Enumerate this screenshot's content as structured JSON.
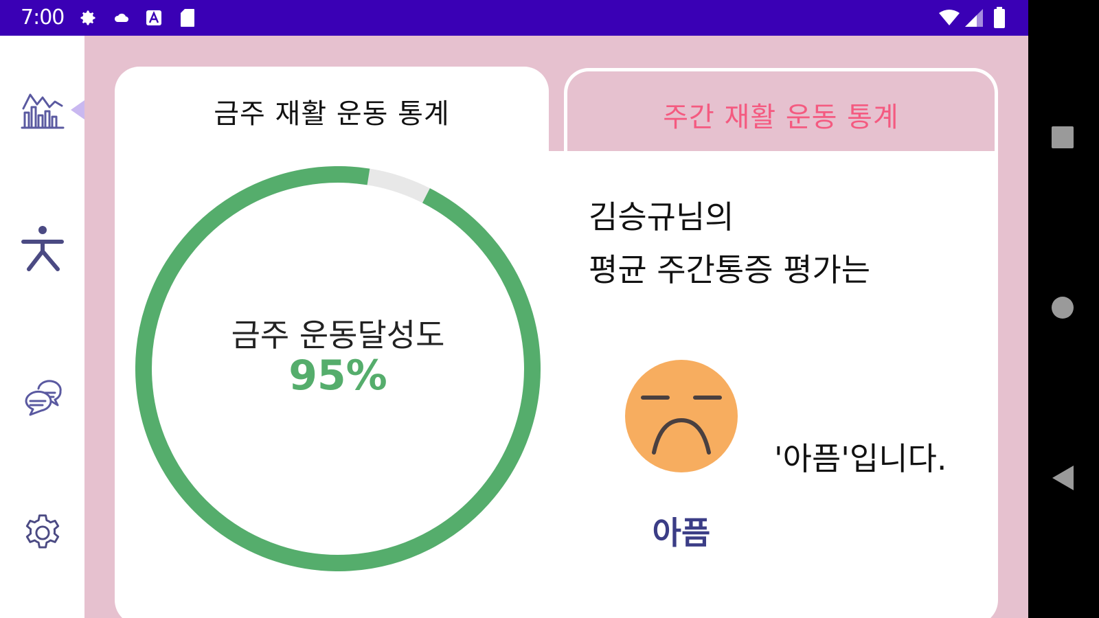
{
  "status_bar": {
    "time": "7:00",
    "icons_left": [
      "gear-icon",
      "cloud-icon",
      "text-a-icon",
      "sd-card-icon"
    ],
    "icons_right": [
      "wifi-icon",
      "cell-signal-icon",
      "battery-icon"
    ]
  },
  "sidebar": {
    "items": [
      {
        "icon": "statistics-chart-icon",
        "selected": true
      },
      {
        "icon": "exercise-person-icon",
        "selected": false
      },
      {
        "icon": "chat-bubbles-icon",
        "selected": false
      },
      {
        "icon": "settings-gear-icon",
        "selected": false
      }
    ]
  },
  "tabs": [
    {
      "label": "금주 재활 운동 통계",
      "active": true
    },
    {
      "label": "주간 재활 운동 통계",
      "active": false
    }
  ],
  "gauge": {
    "label": "금주 운동달성도",
    "value_text": "95%",
    "value": 95
  },
  "evaluation": {
    "line1": "김승규님의",
    "line2": "평균 주간통증 평가는",
    "pain_label": "아픔",
    "result": "'아픔'입니다.",
    "face_icon": "sad-face-icon"
  },
  "colors": {
    "status_bar": "#3a00b5",
    "main_background": "#e6c1cf",
    "gauge_progress": "#55ad6c",
    "gauge_track": "#e8e8e8",
    "inactive_tab_text": "#f45a80",
    "face": "#f7ad5f",
    "pain_label": "#3b3d86",
    "nav_icon": "#4b4a83"
  },
  "android_nav": [
    "recents-square-icon",
    "home-circle-icon",
    "back-triangle-icon"
  ]
}
